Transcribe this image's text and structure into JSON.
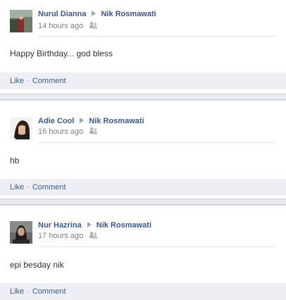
{
  "posts": [
    {
      "author": "Nurul Dianna",
      "recipient": "Nik Rosmawati",
      "timestamp": "14 hours ago",
      "message": "Happy Birthday... god bless",
      "like_label": "Like",
      "separator": "·",
      "comment_label": "Comment"
    },
    {
      "author": "Adie Cool",
      "recipient": "Nik Rosmawati",
      "timestamp": "16 hours ago",
      "message": "hb",
      "like_label": "Like",
      "separator": "·",
      "comment_label": "Comment"
    },
    {
      "author": "Nur Hazrina",
      "recipient": "Nik Rosmawati",
      "timestamp": "17 hours ago",
      "message": "epi besday nik",
      "like_label": "Like",
      "separator": "·",
      "comment_label": "Comment"
    }
  ],
  "colors": {
    "link": "#3b5998",
    "action_bar": "#edeff4",
    "muted": "#808080"
  }
}
